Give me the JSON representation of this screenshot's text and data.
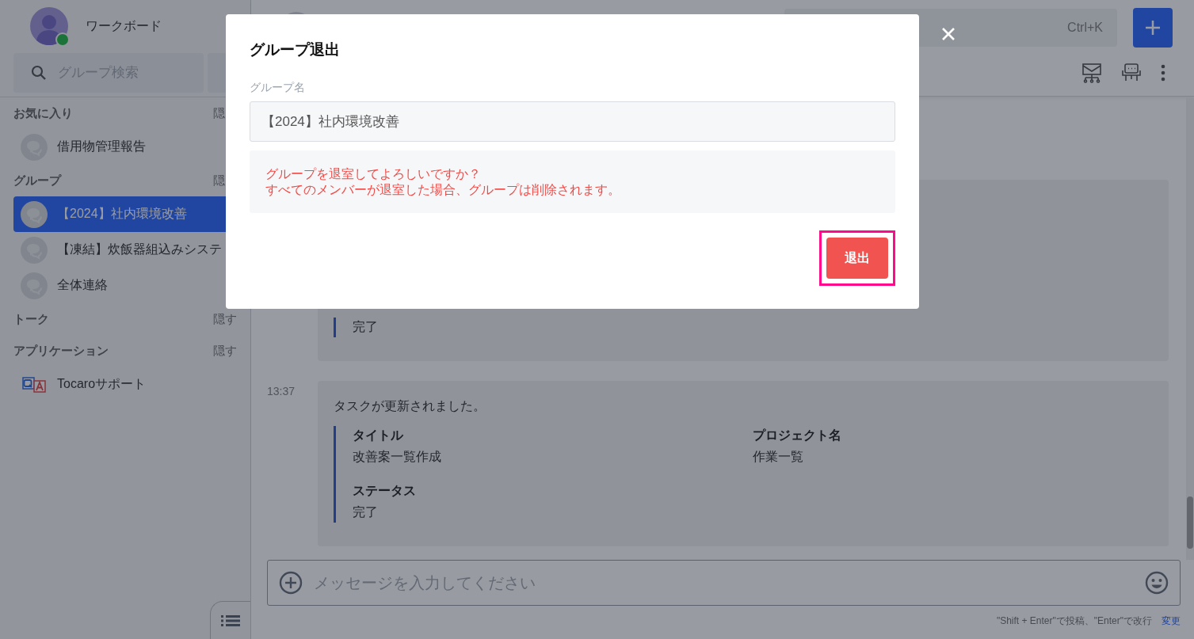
{
  "sidebar": {
    "user_name": "ワークボード",
    "online": true,
    "search": {
      "placeholder": "グループ検索"
    },
    "sections": [
      {
        "title": "お気に入り",
        "toggle": "隠",
        "items": [
          {
            "label": "借用物管理報告",
            "selected": false,
            "kind": "chat"
          }
        ]
      },
      {
        "title": "グループ",
        "toggle": "隠",
        "items": [
          {
            "label": "【2024】社内環境改善",
            "selected": true,
            "kind": "chat"
          },
          {
            "label": "【凍結】炊飯器組込みシステ",
            "selected": false,
            "kind": "chat"
          },
          {
            "label": "全体連絡",
            "selected": false,
            "kind": "chat"
          }
        ]
      },
      {
        "title": "トーク",
        "toggle": "隠す"
      },
      {
        "title": "アプリケーション",
        "toggle": "隠す",
        "items": [
          {
            "label": "Tocaroサポート",
            "selected": false,
            "kind": "app"
          }
        ]
      }
    ]
  },
  "chat": {
    "messages": [
      {
        "fields": [
          {
            "value": "完了"
          }
        ]
      },
      {
        "time": "13:37",
        "text": "タスクが更新されました。",
        "fields": [
          {
            "label": "タイトル",
            "value": "改善案一覧作成"
          },
          {
            "label": "プロジェクト名",
            "value": "作業一覧"
          },
          {
            "label": "ステータス",
            "value": "完了"
          }
        ]
      }
    ],
    "composer": {
      "placeholder": "メッセージを入力してください",
      "hint": "\"Shift + Enter\"で投稿、\"Enter\"で改行",
      "hint_link": "変更"
    },
    "search_shortcut": "Ctrl+K"
  },
  "dialog": {
    "title": "グループ退出",
    "field_label": "グループ名",
    "field_value": "【2024】社内環境改善",
    "warning": [
      "グループを退室してよろしいですか？",
      "すべてのメンバーが退室した場合、グループは削除されます。"
    ],
    "button": {
      "label": "退出",
      "highlighted": true
    }
  }
}
